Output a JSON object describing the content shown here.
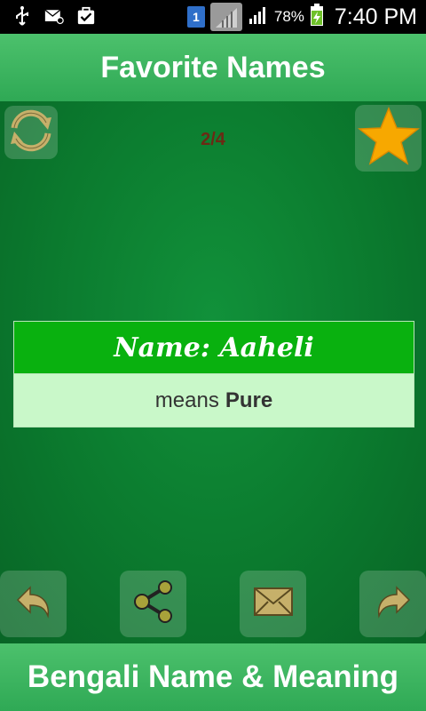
{
  "status_bar": {
    "icons": [
      "usb-icon",
      "email-icon",
      "task-icon",
      "sim-icon",
      "signal-icon",
      "signal-icon",
      "battery-charging-icon"
    ],
    "sim_number": "1",
    "battery": "78%",
    "time": "7:40 PM"
  },
  "header": {
    "title": "Favorite Names"
  },
  "main": {
    "counter": "2/4",
    "card": {
      "name": "Name: Aaheli",
      "means_prefix": "means",
      "meaning": "Pure"
    },
    "top_buttons": [
      "refresh-icon",
      "star-icon"
    ],
    "bottom_buttons": [
      "back-arrow-icon",
      "share-icon",
      "envelope-icon",
      "forward-arrow-icon"
    ]
  },
  "footer": {
    "title": "Bengali Name & Meaning"
  },
  "colors": {
    "header": "#3cb761",
    "background": "#0b7a2e",
    "card_header": "#09b10f",
    "card_body": "#c9f8c9",
    "star": "#f7a800",
    "counter": "#6b2a14"
  }
}
